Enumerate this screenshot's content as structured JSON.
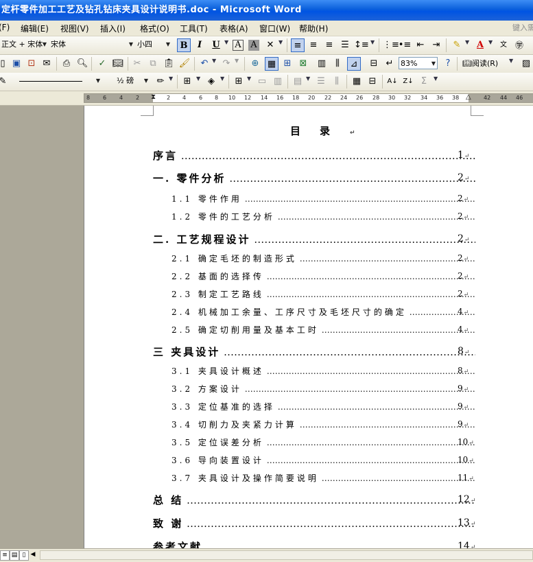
{
  "window": {
    "title": "定杆零件加工工艺及钻孔钻床夹具设计说明书.doc - Microsoft Word"
  },
  "menubar": {
    "items": [
      "(F)",
      "编辑(E)",
      "视图(V)",
      "插入(I)",
      "格式(O)",
      "工具(T)",
      "表格(A)",
      "窗口(W)",
      "帮助(H)"
    ],
    "help_box": "键入需"
  },
  "formatting": {
    "style": "正文 + 宋体",
    "font": "宋体",
    "size": "小四",
    "zoom": "83%",
    "read_label": "阅读(R)",
    "line_weight": "½ 磅"
  },
  "ruler": {
    "ticks": [
      "8",
      "6",
      "4",
      "2",
      "2",
      "4",
      "6",
      "8",
      "10",
      "12",
      "14",
      "16",
      "18",
      "20",
      "22",
      "24",
      "26",
      "28",
      "30",
      "32",
      "34",
      "36",
      "38",
      "42",
      "44",
      "46"
    ]
  },
  "document": {
    "heading": "目录",
    "entries": [
      {
        "text": "序言",
        "page": "1",
        "level": 1
      },
      {
        "text": "一. 零件分析",
        "page": "2",
        "level": 1
      },
      {
        "text": "1.1 零件作用",
        "page": "2",
        "level": 2
      },
      {
        "text": "1.2 零件的工艺分析",
        "page": "2",
        "level": 2
      },
      {
        "text": "二. 工艺规程设计",
        "page": "2",
        "level": 1
      },
      {
        "text": "2.1 确定毛坯的制造形式",
        "page": "2",
        "level": 2
      },
      {
        "text": "2.2 基面的选择传",
        "page": "2",
        "level": 2
      },
      {
        "text": "2.3 制定工艺路线",
        "page": "2",
        "level": 2
      },
      {
        "text": "2.4 机械加工余量、工序尺寸及毛坯尺寸的确定",
        "page": "4",
        "level": 2
      },
      {
        "text": "2.5 确定切削用量及基本工时",
        "page": "4",
        "level": 2
      },
      {
        "text": "三 夹具设计",
        "page": "8",
        "level": 1
      },
      {
        "text": "3.1 夹具设计概述",
        "page": "8",
        "level": 2
      },
      {
        "text": "3.2 方案设计",
        "page": "9",
        "level": 2
      },
      {
        "text": "3.3 定位基准的选择",
        "page": "9",
        "level": 2
      },
      {
        "text": "3.4 切削力及夹紧力计算",
        "page": "9",
        "level": 2
      },
      {
        "text": "3.5 定位误差分析",
        "page": "10",
        "level": 2
      },
      {
        "text": "3.6 导向装置设计",
        "page": "10",
        "level": 2
      },
      {
        "text": "3.7 夹具设计及操作简要说明",
        "page": "11",
        "level": 2
      },
      {
        "text": "总 结",
        "page": "12",
        "level": 1
      },
      {
        "text": "致 谢",
        "page": "13",
        "level": 1
      },
      {
        "text": "参考文献",
        "page": "14",
        "level": 1
      }
    ]
  },
  "icons": [
    "new-doc-icon",
    "save-icon",
    "permission-icon",
    "print-icon",
    "print-preview-icon",
    "spelling-icon",
    "cut-icon",
    "copy-icon",
    "paste-icon",
    "format-painter-icon",
    "undo-icon",
    "redo-icon",
    "hyperlink-icon",
    "tables-borders-icon",
    "insert-table-icon",
    "insert-excel-icon",
    "columns-icon",
    "drawing-icon",
    "document-map-icon",
    "show-hide-icon",
    "help-icon",
    "read-icon"
  ]
}
